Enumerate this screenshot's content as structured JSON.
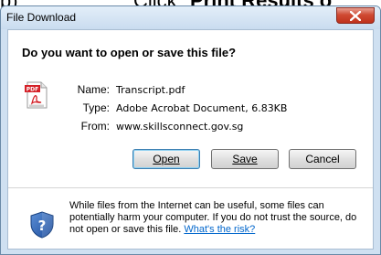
{
  "page_text": {
    "prefix": "b)",
    "action": "Click",
    "emphasis": "Print Results o"
  },
  "dialog": {
    "title": "File Download",
    "question": "Do you want to open or save this file?",
    "file": {
      "name_label": "Name:",
      "name_value": "Transcript.pdf",
      "type_label": "Type:",
      "type_value": "Adobe Acrobat Document, 6.83KB",
      "from_label": "From:",
      "from_value": "www.skillsconnect.gov.sg"
    },
    "buttons": {
      "open_label": "Open",
      "save_label": "Save",
      "cancel_label": "Cancel"
    },
    "warning": {
      "text": "While files from the Internet can be useful, some files can potentially harm your computer. If you do not trust the source, do not open or save this file. ",
      "link_text": "What's the risk?"
    },
    "icons": {
      "file": "pdf-file-icon",
      "security": "shield-question-icon",
      "close": "close-icon"
    }
  }
}
